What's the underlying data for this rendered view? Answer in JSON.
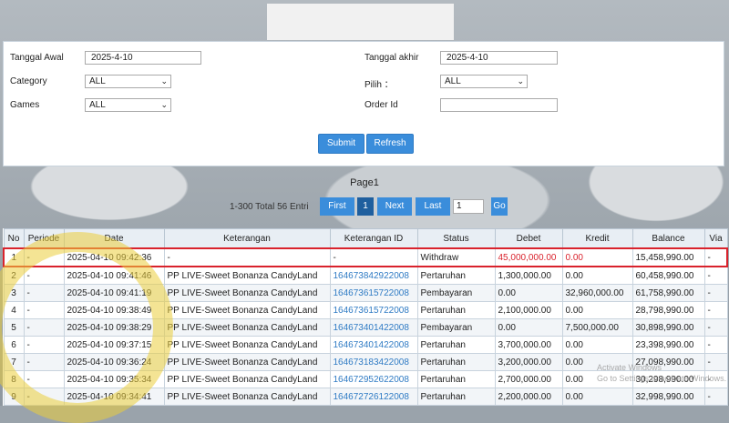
{
  "filters": {
    "tanggal_awal_label": "Tanggal Awal",
    "tanggal_awal_value": "2025-4-10",
    "tanggal_akhir_label": "Tanggal akhir",
    "tanggal_akhir_value": "2025-4-10",
    "category_label": "Category",
    "category_value": "ALL",
    "pilih_label": "Pilih ：",
    "pilih_value": "ALL",
    "games_label": "Games",
    "games_value": "ALL",
    "order_id_label": "Order Id",
    "order_id_value": "",
    "submit_label": "Submit",
    "refresh_label": "Refresh"
  },
  "pager": {
    "title": "Page1",
    "total": "1-300 Total 56 Entri",
    "first": "First",
    "current": "1",
    "next": "Next",
    "last": "Last",
    "page_input": "1",
    "go": "Go"
  },
  "table": {
    "headers": [
      "No",
      "Periode",
      "Date",
      "Keterangan",
      "Keterangan ID",
      "Status",
      "Debet",
      "Kredit",
      "Balance",
      "Via"
    ],
    "rows": [
      {
        "no": "1",
        "periode": "-",
        "date": "2025-04-10 09:42:36",
        "ket": "-",
        "ket_id": "-",
        "status": "Withdraw",
        "debet": "45,000,000.00",
        "kredit": "0.00",
        "balance": "15,458,990.00",
        "via": "-"
      },
      {
        "no": "2",
        "periode": "-",
        "date": "2025-04-10 09:41:46",
        "ket": "PP LIVE-Sweet Bonanza CandyLand",
        "ket_id": "164673842922008",
        "status": "Pertaruhan",
        "debet": "1,300,000.00",
        "kredit": "0.00",
        "balance": "60,458,990.00",
        "via": "-"
      },
      {
        "no": "3",
        "periode": "-",
        "date": "2025-04-10 09:41:19",
        "ket": "PP LIVE-Sweet Bonanza CandyLand",
        "ket_id": "164673615722008",
        "status": "Pembayaran",
        "debet": "0.00",
        "kredit": "32,960,000.00",
        "balance": "61,758,990.00",
        "via": "-"
      },
      {
        "no": "4",
        "periode": "-",
        "date": "2025-04-10 09:38:49",
        "ket": "PP LIVE-Sweet Bonanza CandyLand",
        "ket_id": "164673615722008",
        "status": "Pertaruhan",
        "debet": "2,100,000.00",
        "kredit": "0.00",
        "balance": "28,798,990.00",
        "via": "-"
      },
      {
        "no": "5",
        "periode": "-",
        "date": "2025-04-10 09:38:29",
        "ket": "PP LIVE-Sweet Bonanza CandyLand",
        "ket_id": "164673401422008",
        "status": "Pembayaran",
        "debet": "0.00",
        "kredit": "7,500,000.00",
        "balance": "30,898,990.00",
        "via": "-"
      },
      {
        "no": "6",
        "periode": "-",
        "date": "2025-04-10 09:37:15",
        "ket": "PP LIVE-Sweet Bonanza CandyLand",
        "ket_id": "164673401422008",
        "status": "Pertaruhan",
        "debet": "3,700,000.00",
        "kredit": "0.00",
        "balance": "23,398,990.00",
        "via": "-"
      },
      {
        "no": "7",
        "periode": "-",
        "date": "2025-04-10 09:36:24",
        "ket": "PP LIVE-Sweet Bonanza CandyLand",
        "ket_id": "164673183422008",
        "status": "Pertaruhan",
        "debet": "3,200,000.00",
        "kredit": "0.00",
        "balance": "27,098,990.00",
        "via": "-"
      },
      {
        "no": "8",
        "periode": "-",
        "date": "2025-04-10 09:35:34",
        "ket": "PP LIVE-Sweet Bonanza CandyLand",
        "ket_id": "164672952622008",
        "status": "Pertaruhan",
        "debet": "2,700,000.00",
        "kredit": "0.00",
        "balance": "30,298,990.00",
        "via": "-"
      },
      {
        "no": "9",
        "periode": "-",
        "date": "2025-04-10 09:34:41",
        "ket": "PP LIVE-Sweet Bonanza CandyLand",
        "ket_id": "164672726122008",
        "status": "Pertaruhan",
        "debet": "2,200,000.00",
        "kredit": "0.00",
        "balance": "32,998,990.00",
        "via": "-"
      }
    ]
  },
  "overlay": {
    "watermark": "MWYJK",
    "activate_line1": "Activate Windows",
    "activate_line2": "Go to Settings to activate Windows."
  },
  "colors": {
    "accent": "#3a8ddb",
    "highlight": "#d9222c",
    "link": "#2f7bc4"
  }
}
